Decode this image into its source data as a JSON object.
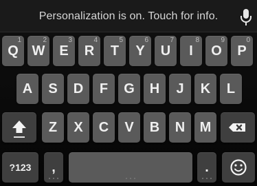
{
  "suggestion_bar": {
    "text": "Personalization is on. Touch for info.",
    "mic_icon": "microphone-icon"
  },
  "rows": [
    {
      "keys": [
        {
          "label": "Q",
          "hint": "1"
        },
        {
          "label": "W",
          "hint": "2"
        },
        {
          "label": "E",
          "hint": "3"
        },
        {
          "label": "R",
          "hint": "4"
        },
        {
          "label": "T",
          "hint": "5"
        },
        {
          "label": "Y",
          "hint": "6"
        },
        {
          "label": "U",
          "hint": "7"
        },
        {
          "label": "I",
          "hint": "8"
        },
        {
          "label": "O",
          "hint": "9"
        },
        {
          "label": "P",
          "hint": "0"
        }
      ]
    },
    {
      "keys": [
        {
          "label": "A"
        },
        {
          "label": "S"
        },
        {
          "label": "D"
        },
        {
          "label": "F"
        },
        {
          "label": "G"
        },
        {
          "label": "H"
        },
        {
          "label": "J"
        },
        {
          "label": "K"
        },
        {
          "label": "L"
        }
      ]
    },
    {
      "keys": [
        {
          "label": "Z"
        },
        {
          "label": "X"
        },
        {
          "label": "C"
        },
        {
          "label": "V"
        },
        {
          "label": "B"
        },
        {
          "label": "N"
        },
        {
          "label": "M"
        }
      ],
      "shift_icon": "shift-arrow-icon",
      "backspace_icon": "backspace-icon"
    },
    {
      "symbols_label": "?123",
      "comma_label": ",",
      "period_label": ".",
      "emoji_icon": "smiley-emoji-icon"
    }
  ],
  "colors": {
    "key": "#5a5a5a",
    "special_key": "#3f3f3f",
    "text": "#efefef",
    "background": "#0b0b0b"
  }
}
